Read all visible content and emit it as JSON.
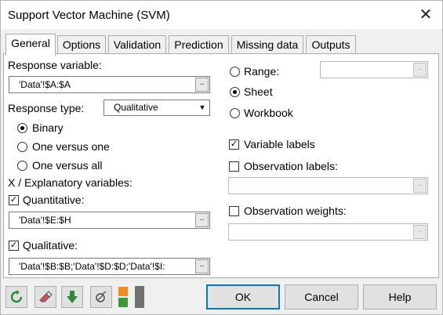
{
  "window": {
    "title": "Support Vector Machine (SVM)",
    "close_symbol": "✕"
  },
  "tabs": [
    {
      "label": "General",
      "active": true
    },
    {
      "label": "Options"
    },
    {
      "label": "Validation"
    },
    {
      "label": "Prediction"
    },
    {
      "label": "Missing data"
    },
    {
      "label": "Outputs"
    }
  ],
  "general": {
    "response_variable_label": "Response variable:",
    "response_variable_value": "'Data'!$A:$A",
    "response_type_label": "Response type:",
    "response_type_value": "Qualitative",
    "response_modes": [
      {
        "label": "Binary",
        "selected": true
      },
      {
        "label": "One versus one",
        "selected": false
      },
      {
        "label": "One versus all",
        "selected": false
      }
    ],
    "explanatory_label": "X / Explanatory variables:",
    "quantitative_label": "Quantitative:",
    "quantitative_checked": true,
    "quantitative_value": "'Data'!$E:$H",
    "qualitative_label": "Qualitative:",
    "qualitative_checked": true,
    "qualitative_value": "'Data'!$B:$B;'Data'!$D:$D;'Data'!$I:",
    "output_targets": [
      {
        "label": "Range:",
        "selected": false
      },
      {
        "label": "Sheet",
        "selected": true
      },
      {
        "label": "Workbook",
        "selected": false
      }
    ],
    "range_value": "",
    "variable_labels_label": "Variable labels",
    "variable_labels_checked": true,
    "observation_labels_label": "Observation labels:",
    "observation_labels_checked": false,
    "observation_labels_value": "",
    "observation_weights_label": "Observation weights:",
    "observation_weights_checked": false,
    "observation_weights_value": "",
    "ref_button_symbol": "..",
    "dropdown_symbol": "▼",
    "check_symbol": "✓"
  },
  "footer": {
    "ok_label": "OK",
    "cancel_label": "Cancel",
    "help_label": "Help"
  },
  "colors": {
    "accent": "#0078d7",
    "reset_icon": "#2e8b3a",
    "eraser_icon": "#d94f4f",
    "down_arrow_icon": "#2e8b3a",
    "orange_block": "#f28c1e",
    "green_block": "#3a9a3a",
    "gray_block": "#707070"
  }
}
